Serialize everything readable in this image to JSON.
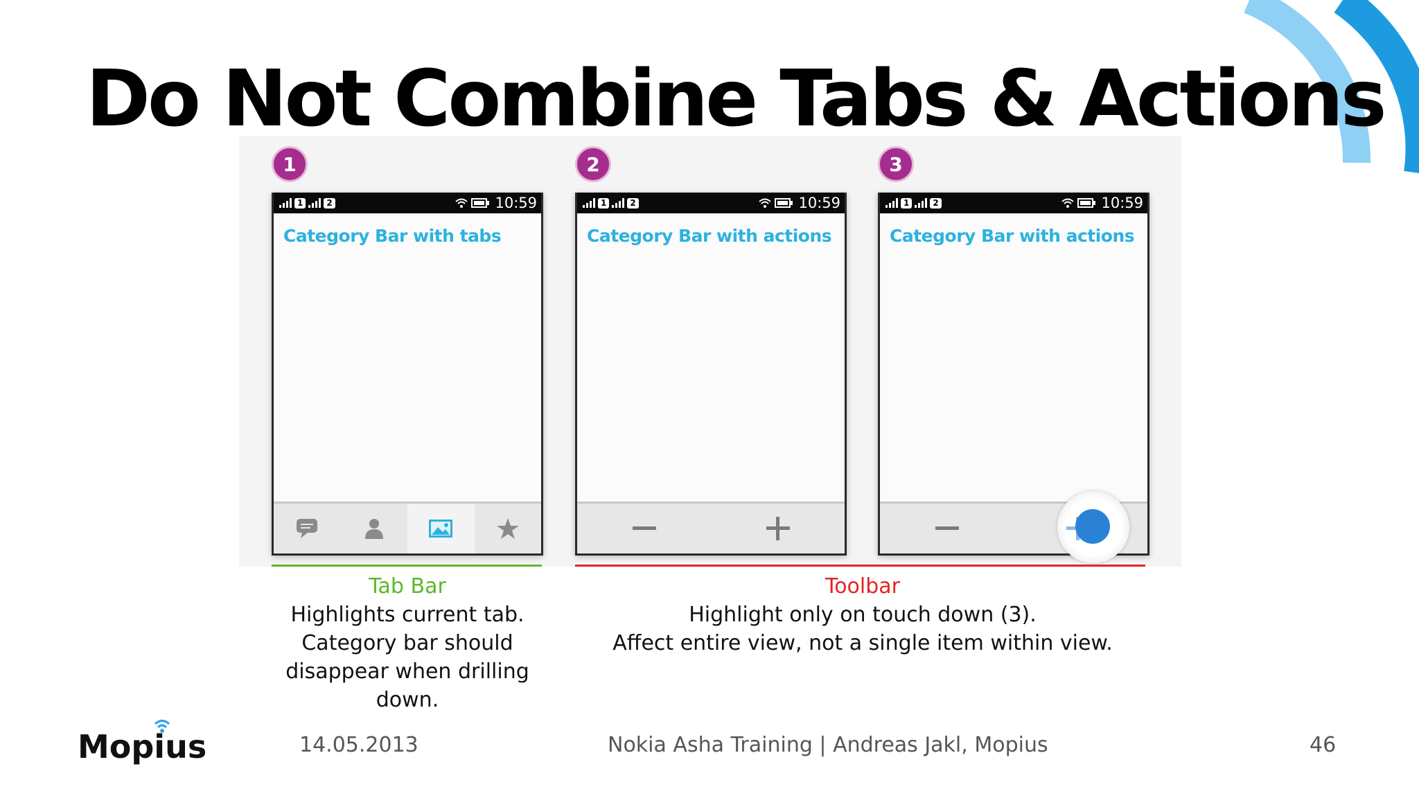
{
  "slide": {
    "title": "Do Not Combine Tabs & Actions",
    "accent_color": "#2aa3e8"
  },
  "steps": [
    {
      "number": "1"
    },
    {
      "number": "2"
    },
    {
      "number": "3"
    }
  ],
  "phones": [
    {
      "status": {
        "sim1": "1",
        "sim2": "2",
        "time": "10:59"
      },
      "header": "Category Bar with tabs",
      "bar_type": "tab-bar",
      "tabs": [
        {
          "icon": "chat-bubble-icon"
        },
        {
          "icon": "person-icon"
        },
        {
          "icon": "image-icon",
          "active": true
        },
        {
          "icon": "star-icon"
        }
      ]
    },
    {
      "status": {
        "sim1": "1",
        "sim2": "2",
        "time": "10:59"
      },
      "header": "Category Bar with actions",
      "bar_type": "toolbar",
      "actions": [
        {
          "icon": "minus-icon"
        },
        {
          "icon": "plus-icon"
        }
      ]
    },
    {
      "status": {
        "sim1": "1",
        "sim2": "2",
        "time": "10:59"
      },
      "header": "Category Bar with actions",
      "bar_type": "toolbar",
      "actions": [
        {
          "icon": "minus-icon"
        },
        {
          "icon": "plus-icon",
          "pressed": true
        }
      ]
    }
  ],
  "captions": {
    "tab_bar": {
      "title": "Tab Bar",
      "title_color": "#5cb82a",
      "lines": [
        "Highlights current tab.",
        "Category bar should",
        "disappear when drilling",
        "down."
      ]
    },
    "toolbar": {
      "title": "Toolbar",
      "title_color": "#e52323",
      "lines": [
        "Highlight only on touch down (3).",
        "Affect entire view, not a single item within view."
      ]
    }
  },
  "footer": {
    "logo_text": "Mopius",
    "date": "14.05.2013",
    "center": "Nokia Asha Training | Andreas Jakl, Mopius",
    "page": "46"
  }
}
